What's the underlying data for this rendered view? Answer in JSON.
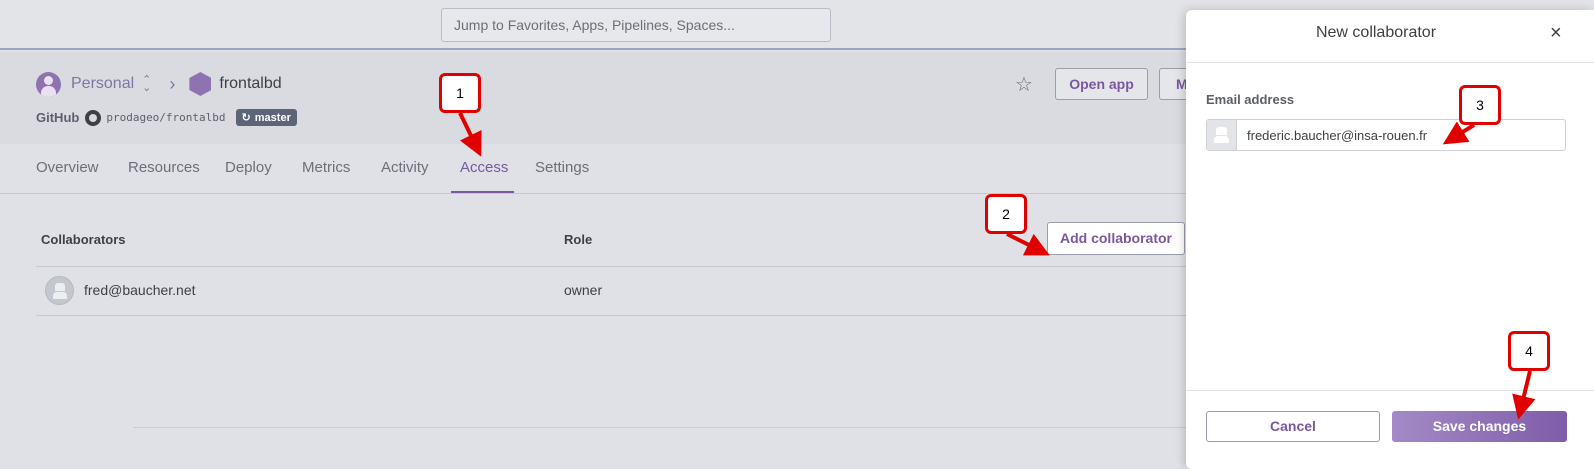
{
  "search": {
    "placeholder": "Jump to Favorites, Apps, Pipelines, Spaces..."
  },
  "header": {
    "team": "Personal",
    "app_name": "frontalbd",
    "github_label": "GitHub",
    "repo": "prodageo/frontalbd",
    "branch": "master",
    "open_app_label": "Open app",
    "more_label": "M"
  },
  "tabs": [
    {
      "label": "Overview"
    },
    {
      "label": "Resources"
    },
    {
      "label": "Deploy"
    },
    {
      "label": "Metrics"
    },
    {
      "label": "Activity"
    },
    {
      "label": "Access",
      "active": true
    },
    {
      "label": "Settings"
    }
  ],
  "table": {
    "columns": [
      "Collaborators",
      "Role"
    ],
    "rows": [
      {
        "email": "fred@baucher.net",
        "role": "owner"
      }
    ]
  },
  "add_collaborator_label": "Add collaborator",
  "modal": {
    "title": "New collaborator",
    "close_glyph": "×",
    "email_label": "Email address",
    "email_value": "frederic.baucher@insa-rouen.fr",
    "cancel_label": "Cancel",
    "save_label": "Save changes"
  },
  "callouts": [
    "1",
    "2",
    "3",
    "4"
  ],
  "colors": {
    "accent": "#79589f",
    "callout_border": "#e00000"
  }
}
